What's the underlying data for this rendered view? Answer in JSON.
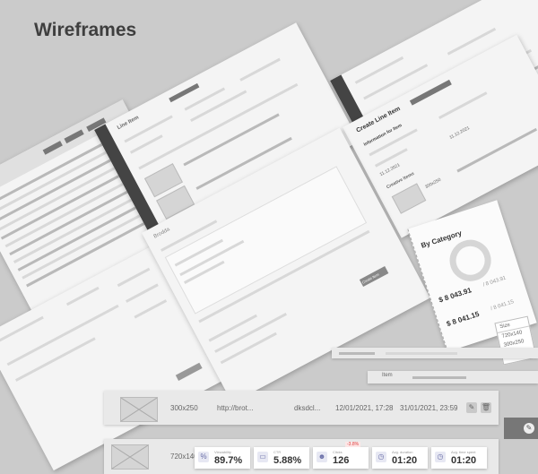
{
  "page": {
    "title": "Wireframes"
  },
  "item_list": {
    "rows": [
      {
        "size": "300x250",
        "url": "http://brot...",
        "url_suffix": "dksdcl...",
        "start": "12/01/2021, 17:28",
        "end": "31/01/2021, 23:59"
      },
      {
        "size": "720x140"
      }
    ]
  },
  "table_header": {
    "label": "Item"
  },
  "create_line_item": {
    "title": "Create Line Item",
    "section": "Information for Item",
    "start_date": "11.12.2021",
    "end_date": "11.12.2021",
    "creative_section": "Creative Items",
    "size": "300x250"
  },
  "category": {
    "title": "By Category",
    "entry1_value": "$ 8 043.91",
    "entry1_sub": "/ 8 043.91",
    "entry2_value": "$ 8 041.15",
    "entry2_sub": "/ 8 041.15",
    "dropdown_selected": "Size",
    "dropdown_options": [
      "720x140",
      "300x250"
    ]
  },
  "stats": [
    {
      "icon": "percent-icon",
      "glyph": "%",
      "label": "Viewability",
      "value": "89.7%"
    },
    {
      "icon": "monitor-icon",
      "glyph": "▭",
      "label": "CTR",
      "value": "5.88%",
      "delta": "-3.8%"
    },
    {
      "icon": "users-icon",
      "glyph": "☻",
      "label": "Clicks",
      "value": "126"
    },
    {
      "icon": "clock-icon",
      "glyph": "◷",
      "label": "Avg. duration",
      "value": "01:20"
    },
    {
      "icon": "clock-icon",
      "glyph": "◷",
      "label": "Avg. time spent",
      "value": "01:20"
    }
  ],
  "editor": {
    "brand": "Brodda",
    "submit_label": "Create Item"
  }
}
